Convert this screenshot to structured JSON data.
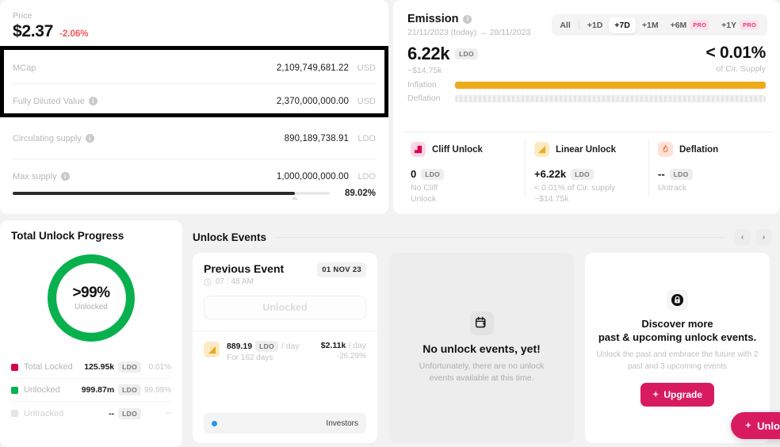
{
  "price": {
    "label": "Price",
    "value": "$2.37",
    "change": "-2.06%",
    "change_color": "#f5555c"
  },
  "stats": [
    {
      "name": "MCap",
      "value": "2,109,749,681.22",
      "unit": "USD",
      "has_info": false
    },
    {
      "name": "Fully Diluted Value",
      "value": "2,370,000,000.00",
      "unit": "USD",
      "has_info": true
    },
    {
      "name": "Circulating supply",
      "value": "890,189,738.91",
      "unit": "LDO",
      "has_info": true
    },
    {
      "name": "Max supply",
      "value": "1,000,000,000.00",
      "unit": "LDO",
      "has_info": true
    }
  ],
  "supply_progress": {
    "percent_label": "89.02%",
    "percent": 89.02
  },
  "emission": {
    "title": "Emission",
    "dates": "21/11/2023 (today) → 28/11/2023",
    "ranges": [
      {
        "label": "All",
        "active": false,
        "pro": false
      },
      {
        "label": "+1D",
        "active": false,
        "pro": false
      },
      {
        "label": "+7D",
        "active": true,
        "pro": false
      },
      {
        "label": "+1M",
        "active": false,
        "pro": false
      },
      {
        "label": "+6M",
        "active": false,
        "pro": true,
        "pro_label": "PRO"
      },
      {
        "label": "+1Y",
        "active": false,
        "pro": true,
        "pro_label": "PRO"
      }
    ],
    "amount": "6.22k",
    "ticker": "LDO",
    "amount_usd": "~$14.75k",
    "pct": "< 0.01%",
    "pct_sub": "of Cir. Supply",
    "inflation_label": "Inflation",
    "deflation_label": "Deflation",
    "inflation_fill_pct": 100,
    "inflation_color": "#eeab19"
  },
  "unlock_types": [
    {
      "name": "Cliff Unlock",
      "icon": "cliff-unlock-icon",
      "value": "0",
      "ticker": "LDO",
      "desc_line1": "No Cliff",
      "desc_line2": "Unlock",
      "desc_line3": ""
    },
    {
      "name": "Linear Unlock",
      "icon": "linear-unlock-icon",
      "value": "+6.22k",
      "ticker": "LDO",
      "desc_line1": "< 0.01% of Cir. supply",
      "desc_line2": "~$14.75k",
      "desc_line3": ""
    },
    {
      "name": "Deflation",
      "icon": "flame-icon",
      "value": "--",
      "ticker": "LDO",
      "desc_line1": "Untrack",
      "desc_line2": "",
      "desc_line3": ""
    }
  ],
  "unlock_progress": {
    "title": "Total Unlock Progress",
    "donut_pct": ">99%",
    "donut_label": "Unlocked",
    "donut_color": "#08b14e",
    "legend": [
      {
        "name": "Total Locked",
        "value": "125.95k",
        "ticker": "LDO",
        "pct": "0.01%",
        "color": "#d6004f"
      },
      {
        "name": "Unlocked",
        "value": "999.87m",
        "ticker": "LDO",
        "pct": "99.99%",
        "color": "#08b14e"
      },
      {
        "name": "Untracked",
        "value": "--",
        "ticker": "LDO",
        "pct": "--",
        "color": "#e4e4e4"
      }
    ]
  },
  "events_section": {
    "title": "Unlock Events",
    "prev_arrow": "‹",
    "next_arrow": "›"
  },
  "previous_event": {
    "title": "Previous Event",
    "date_chip": "01 NOV 23",
    "time": "07 : 48 AM",
    "status": "Unlocked",
    "detail": {
      "amount": "889.19",
      "ticker": "LDO",
      "per": "/ day",
      "duration": "For 162 days",
      "usd": "$2.11k",
      "usd_per": "/ day",
      "change": "-26.29%"
    },
    "footer_label": "Investors",
    "footer_dot_color": "#2196f3"
  },
  "empty_card": {
    "icon": "calendar-question-icon",
    "title": "No unlock events, yet!",
    "subtitle": "Unfortunately, there are no unlock events available at this time."
  },
  "discover_card": {
    "icon": "lock-icon",
    "line1": "Discover more",
    "line2": "past & upcoming unlock events.",
    "subtitle": "Unlock the past and embrace the future with 2 past and 3 upcoming events",
    "button_label": "Upgrade",
    "button_color": "#d81b60"
  },
  "float_button": {
    "label": "Unlo",
    "color": "#d81b60"
  }
}
